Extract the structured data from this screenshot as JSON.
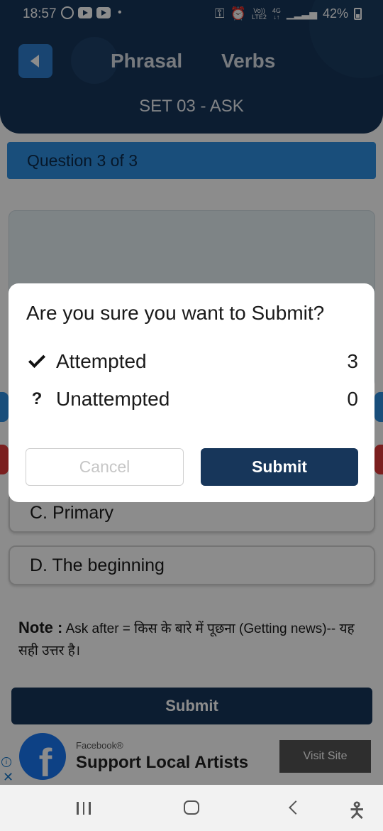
{
  "status_bar": {
    "time": "18:57",
    "network_top": "Vo))",
    "network_bottom": "LTE2",
    "net_gen": "4G",
    "battery": "42%"
  },
  "header": {
    "title_word1": "Phrasal",
    "title_word2": "Verbs",
    "subtitle": "SET 03 - ASK"
  },
  "question": {
    "counter": "Question 3 of 3"
  },
  "options": [
    {
      "label": "C. Primary"
    },
    {
      "label": "D. The beginning"
    }
  ],
  "note": {
    "label": "Note :",
    "text": "Ask after =  किस के बारे में पूछना (Getting news)-- यह सही उत्तर है।"
  },
  "submit_button": "Submit",
  "ad": {
    "brand": "Facebook®",
    "headline": "Support Local Artists",
    "cta": "Visit Site",
    "info_icon": "i",
    "close_icon": "✕"
  },
  "dialog": {
    "title": "Are you sure you want to Submit?",
    "attempted_label": "Attempted",
    "attempted_count": "3",
    "unattempted_mark": "?",
    "unattempted_label": "Unattempted",
    "unattempted_count": "0",
    "cancel": "Cancel",
    "submit": "Submit"
  },
  "colors": {
    "header_bg": "#17365a",
    "accent_blue": "#2f8fe0",
    "dialog_button": "#17365a"
  }
}
